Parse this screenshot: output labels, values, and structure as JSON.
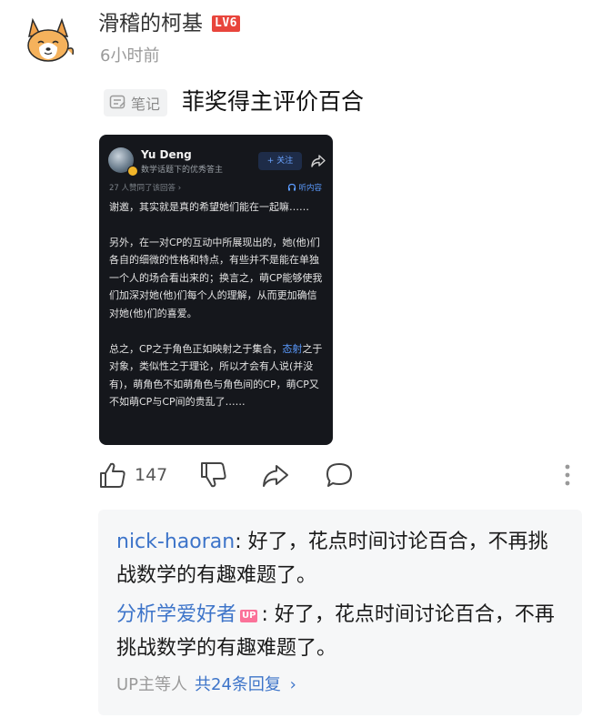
{
  "post": {
    "username": "滑稽的柯基",
    "level_badge": "LV6",
    "timestamp": "6小时前",
    "note_tag": "笔记",
    "title": "菲奖得主评价百合"
  },
  "screenshot": {
    "author": "Yu Deng",
    "author_desc": "数学话题下的优秀答主",
    "follow_label": "+ 关注",
    "upvoted_text": "27 人赞同了该回答 ›",
    "listen_label": "听内容",
    "paragraph_1": "谢邀，其实就是真的希望她们能在一起嘛……",
    "paragraph_2": "另外，在一对CP的互动中所展现出的，她(他)们各自的细微的性格和特点，有些并不是能在单独一个人的场合看出来的；换言之，萌CP能够使我们加深对她(他)们每个人的理解，从而更加确信对她(他)们的喜爱。",
    "paragraph_3_prefix": "总之，CP之于角色正如映射之于集合，",
    "paragraph_3_link": "态射",
    "paragraph_3_suffix": "之于对象，类似性之于理论，所以才会有人说(并没有)，萌角色不如萌角色与角色间的CP，萌CP又不如萌CP与CP间的贵乱了……"
  },
  "actions": {
    "like_count": "147"
  },
  "replies": {
    "items": [
      {
        "author": "nick-haoran",
        "separator": ": ",
        "text": "好了，花点时间讨论百合，不再挑战数学的有趣难题了。"
      },
      {
        "author": "分析学爱好者",
        "badge": "UP",
        "separator": ": ",
        "text": "好了，花点时间讨论百合，不再挑战数学的有趣难题了。"
      }
    ],
    "more_prefix": "UP主等人",
    "more_count": "共24条回复",
    "more_chevron": "›"
  },
  "colors": {
    "link_blue": "#3d74c9",
    "level_red": "#e8453c",
    "up_pink": "#fb7299",
    "screenshot_bg": "#15171c"
  },
  "icons": {
    "avatar": "corgi-avatar",
    "note": "note-icon",
    "like": "thumbs-up-icon",
    "dislike": "thumbs-down-icon",
    "share": "share-icon",
    "comment": "comment-icon",
    "more": "more-vertical-icon"
  }
}
